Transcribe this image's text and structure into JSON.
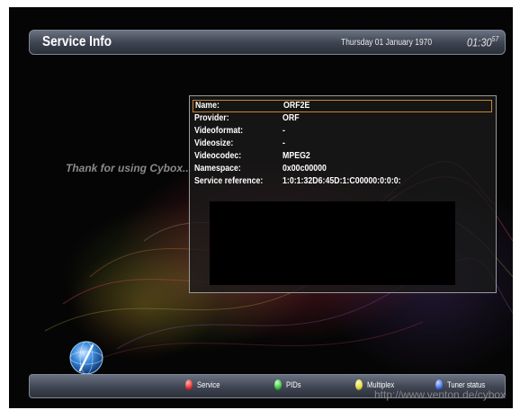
{
  "header": {
    "title": "Service Info",
    "date": "Thursday 01 January 1970",
    "time": "01:30",
    "time_seconds": "57"
  },
  "side_message": "Thank for using Cybox...",
  "service_info": {
    "rows": [
      {
        "label": "Name:",
        "value": "ORF2E"
      },
      {
        "label": "Provider:",
        "value": "ORF"
      },
      {
        "label": "Videoformat:",
        "value": "-"
      },
      {
        "label": "Videosize:",
        "value": "-"
      },
      {
        "label": "Videocodec:",
        "value": "MPEG2"
      },
      {
        "label": "Namespace:",
        "value": "0x00c00000"
      },
      {
        "label": "Service reference:",
        "value": "1:0:1:32D6:45D:1:C00000:0:0:0:"
      }
    ],
    "selected_index": 0
  },
  "colors": {
    "selection_border": "#c9862b",
    "key_red": "#e23030",
    "key_green": "#3bc43b",
    "key_yellow": "#e5d93a",
    "key_blue": "#3f6fe0"
  },
  "bottom_bar": {
    "keys": [
      {
        "color": "red",
        "label": "Service"
      },
      {
        "color": "green",
        "label": "PIDs"
      },
      {
        "color": "yellow",
        "label": "Multiplex"
      },
      {
        "color": "blue",
        "label": "Tuner status"
      }
    ]
  },
  "watermark": "http://www.venton.de/cybox",
  "logo_icon": "cybox-globe-logo-icon"
}
